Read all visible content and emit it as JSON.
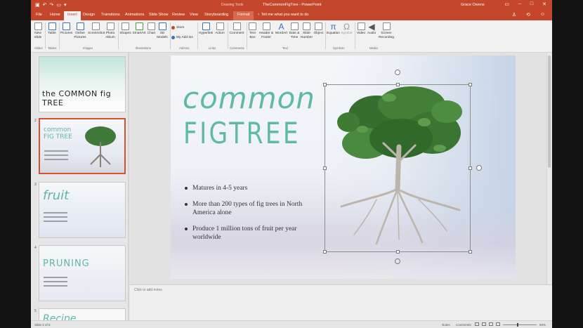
{
  "titlebar": {
    "contextual_label": "Drawing Tools",
    "document_title": "TheCommonFigTree  -  PowerPoint",
    "user_name": "Grace Owens"
  },
  "tabs": [
    "File",
    "Home",
    "Insert",
    "Design",
    "Transitions",
    "Animations",
    "Slide Show",
    "Review",
    "View",
    "Storyboarding",
    "Format"
  ],
  "active_tab": "Insert",
  "tell_me": "Tell me what you want to do",
  "ribbon": {
    "new_slide": "New Slide",
    "table": "Table",
    "pictures": "Pictures",
    "online_pictures": "Online Pictures",
    "screenshot": "Screenshot",
    "photo_album": "Photo Album",
    "shapes": "Shapes",
    "smartart": "SmartArt",
    "chart": "Chart",
    "models_3d": "3D Models",
    "store": "Store",
    "my_addins": "My Add-ins",
    "hyperlink": "Hyperlink",
    "action": "Action",
    "comment": "Comment",
    "text_box": "Text Box",
    "header_footer": "Header & Footer",
    "wordart": "WordArt",
    "date_time": "Date & Time",
    "slide_number": "Slide Number",
    "object": "Object",
    "equation": "Equation",
    "symbol": "Symbol",
    "video": "Video",
    "audio": "Audio",
    "screen_recording": "Screen Recording",
    "groups": {
      "slides": "Slides",
      "tables": "Tables",
      "images": "Images",
      "illustrations": "Illustrations",
      "addins": "Add-ins",
      "links": "Links",
      "comments": "Comments",
      "text": "Text",
      "symbols": "Symbols",
      "media": "Media"
    }
  },
  "thumbnails": [
    {
      "num": "",
      "title": "the COMMON fig TREE"
    },
    {
      "num": "2",
      "title": "common FIG TREE"
    },
    {
      "num": "3",
      "title": "fruit"
    },
    {
      "num": "4",
      "title": "PRUNING"
    },
    {
      "num": "5",
      "title": "Recipe"
    }
  ],
  "slide": {
    "title_line1": "common",
    "title_line2": "FIGTREE",
    "bullets": [
      "Matures in 4-5 years",
      "More than 200 types of fig trees in North America alone",
      "Produce 1 million tons of fruit per year worldwide"
    ]
  },
  "notes_placeholder": "Click to add notes",
  "status": {
    "slide_counter": "Slide 2 of 5",
    "notes": "Notes",
    "comments": "Comments",
    "zoom": "93%"
  },
  "colors": {
    "accent": "#c4472b",
    "title_teal": "#5ebaa5"
  }
}
